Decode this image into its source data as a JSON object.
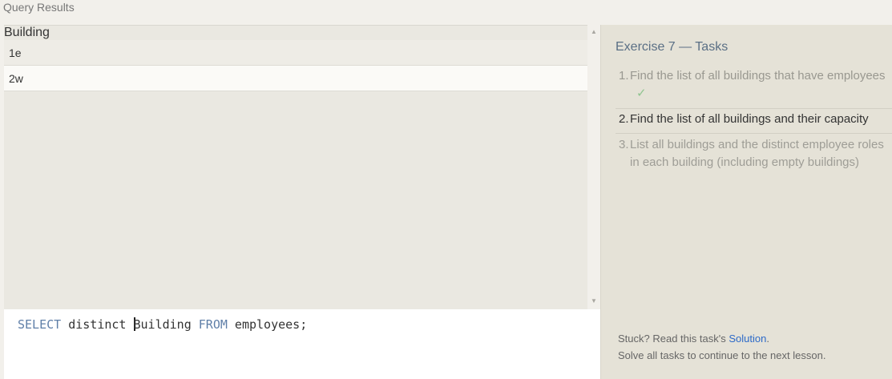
{
  "window": {
    "title": "Query Results"
  },
  "results": {
    "columns": [
      "Building"
    ],
    "rows": [
      [
        "1e"
      ],
      [
        "2w"
      ]
    ]
  },
  "editor": {
    "tokens": [
      "SELECT",
      " distinct ",
      "Building",
      " FROM",
      " employees;"
    ]
  },
  "tasks": {
    "title": "Exercise 7 — Tasks",
    "items": [
      {
        "number": "1.",
        "text": "Find the list of all buildings that have employees",
        "status": "✓"
      },
      {
        "number": "2.",
        "text": "Find the list of all buildings and their capacity"
      },
      {
        "number": "3.",
        "text": "List all buildings and the distinct employee roles in each building (including empty buildings)"
      }
    ],
    "footer_prefix": "Stuck? Read this task's ",
    "footer_link": "Solution",
    "footer_period": ".",
    "footer_line2": "Solve all tasks to continue to the next lesson."
  },
  "colors": {
    "keyword": "#5f7fa8",
    "link": "#2d6ac8",
    "check": "#8fc48f"
  },
  "icons": [
    "scroll-up-arrow-icon",
    "scroll-down-arrow-icon",
    "checkmark-icon"
  ]
}
